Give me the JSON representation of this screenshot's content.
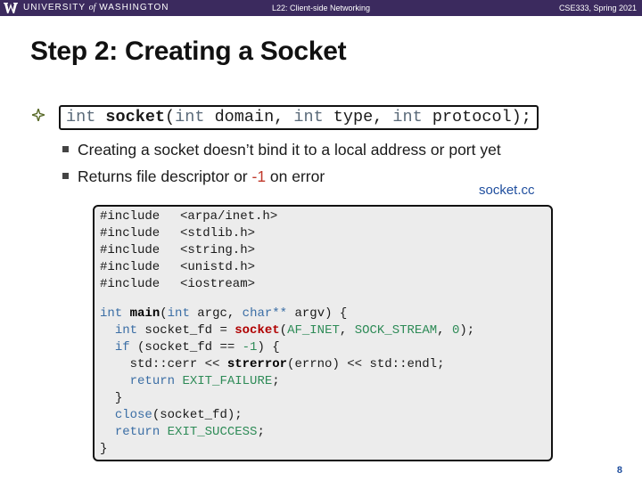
{
  "header": {
    "university": "UNIVERSITY",
    "of": "of",
    "washington": "WASHINGTON",
    "lecture": "L22:  Client-side Networking",
    "course": "CSE333, Spring 2021"
  },
  "title": "Step 2: Creating a Socket",
  "signature": {
    "int": "int",
    "name": "socket",
    "open_paren": "(",
    "int1": "int",
    "domain": " domain, ",
    "int2": "int",
    "type": " type, ",
    "int3": "int",
    "protocol": " protocol);"
  },
  "bullets": {
    "b1": "Creating a socket doesn’t bind it to a local address or port yet",
    "b2_pre": "Returns file descriptor or ",
    "b2_neg": "-1",
    "b2_post": " on error"
  },
  "filename": "socket.cc",
  "code": {
    "includes": [
      {
        "directive": "#include",
        "header": "<arpa/inet.h>"
      },
      {
        "directive": "#include",
        "header": "<stdlib.h>"
      },
      {
        "directive": "#include",
        "header": "<string.h>"
      },
      {
        "directive": "#include",
        "header": "<unistd.h>"
      },
      {
        "directive": "#include",
        "header": "<iostream>"
      }
    ],
    "main_int": "int",
    "main_name": "main",
    "main_int2": "int",
    "main_argc": " argc, ",
    "main_char": "char**",
    "main_rest": " argv) {",
    "l1_int": "int",
    "l1_mid": " socket_fd = ",
    "l1_fn": "socket",
    "l1_open": "(",
    "l1_a1": "AF_INET",
    "l1_comma1": ", ",
    "l1_a2": "SOCK_STREAM",
    "l1_comma2": ", ",
    "l1_a3": "0",
    "l1_end": ");",
    "l2_if": "if",
    "l2_mid": " (socket_fd == ",
    "l2_val": "-1",
    "l2_end": ") {",
    "l3_pre": "std::cerr << ",
    "l3_fn": "strerror",
    "l3_post": "(errno) << std::endl;",
    "l4_ret": "return",
    "l4_val": "EXIT_FAILURE",
    "l4_end": ";",
    "l5": "}",
    "l6_fn": "close",
    "l6_rest": "(socket_fd);",
    "l7_ret": "return",
    "l7_val": "EXIT_SUCCESS",
    "l7_end": ";",
    "l8": "}"
  },
  "page_number": "8",
  "colors": {
    "header_bg": "#3b2a5e",
    "keyword": "#3b6ea5",
    "constant": "#2e8b57",
    "error_red": "#b00000",
    "link_blue": "#1f4e9e"
  }
}
